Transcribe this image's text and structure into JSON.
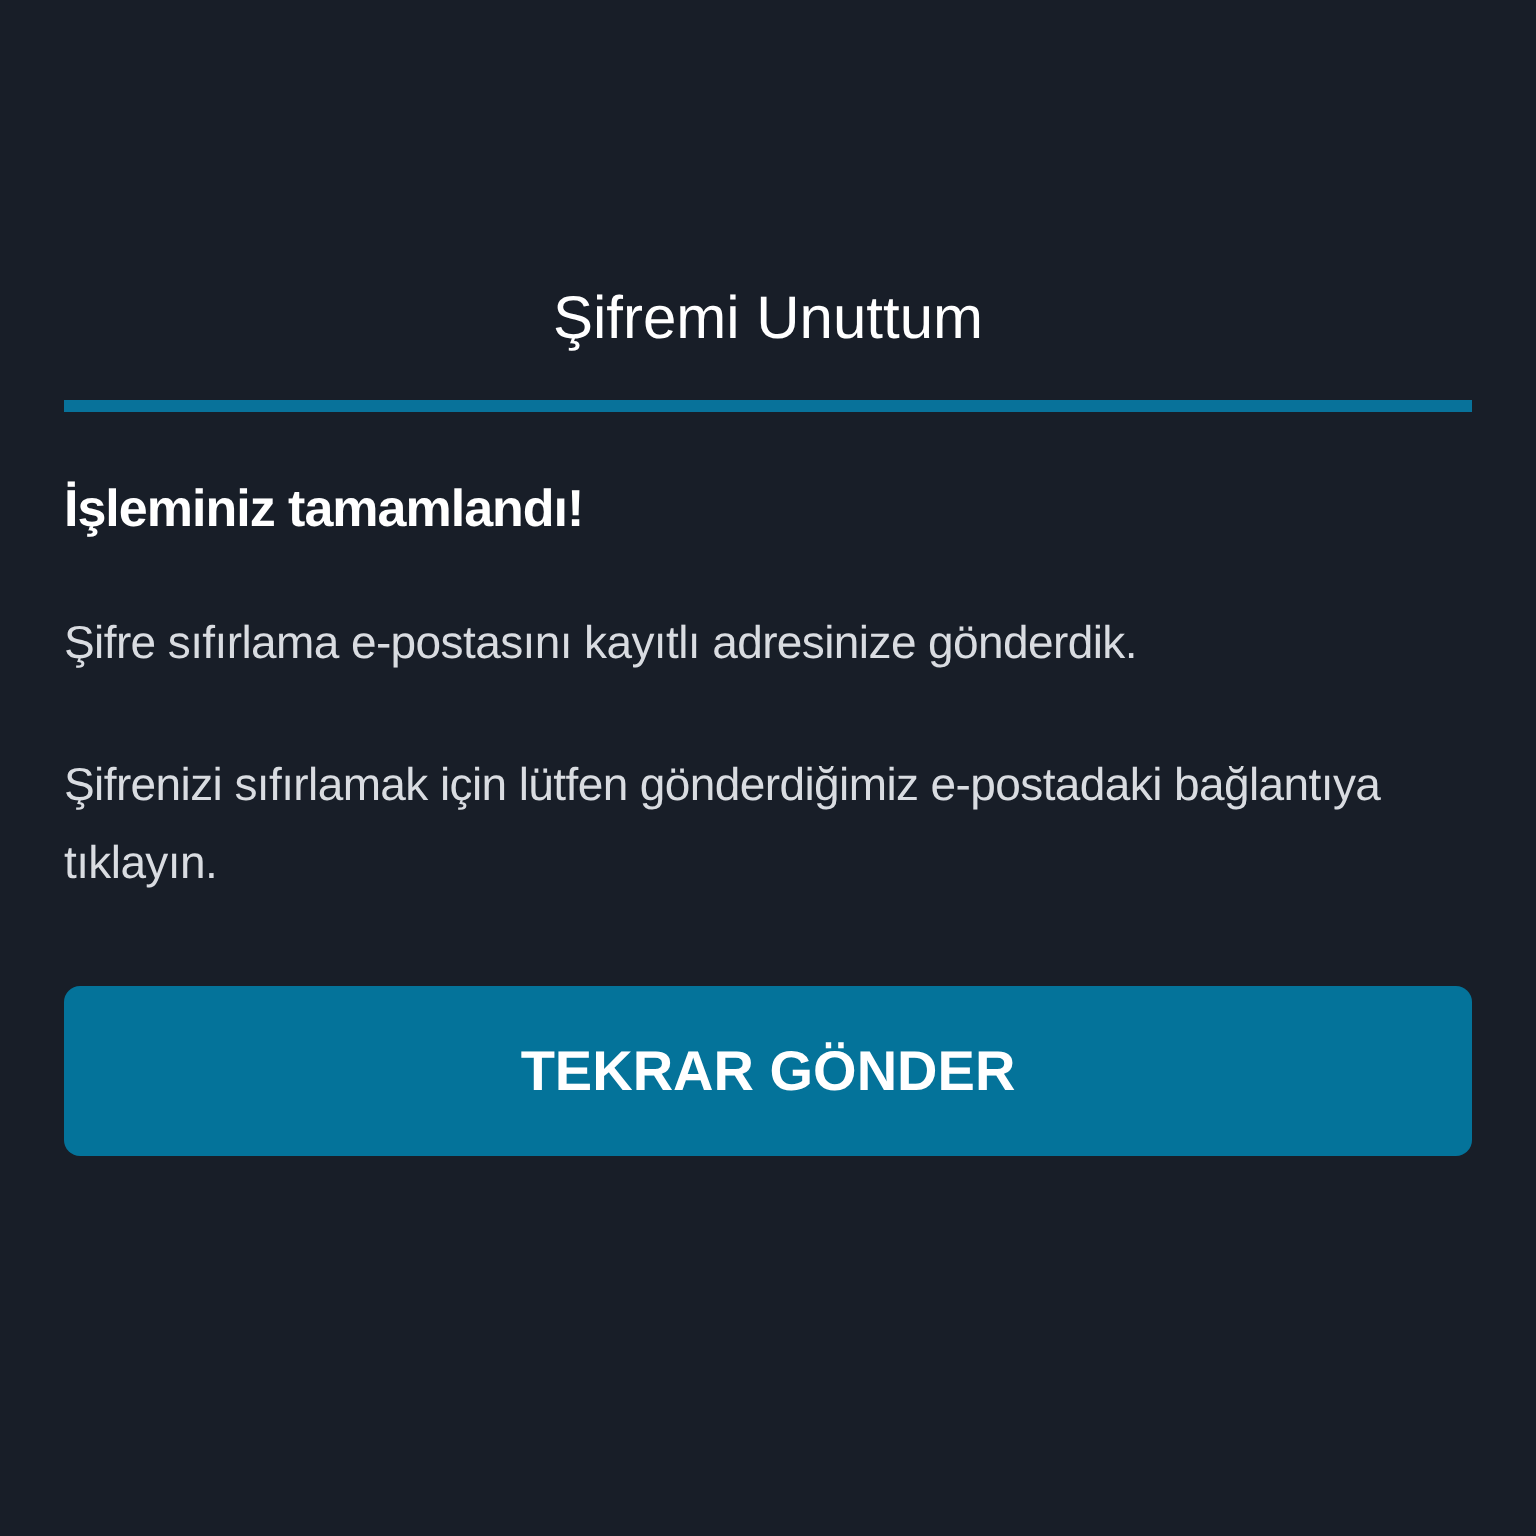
{
  "title": "Şifremi Unuttum",
  "heading": "İşleminiz tamamlandı!",
  "paragraphs": [
    "Şifre sıfırlama e-postasını kayıtlı adresinize gönderdik.",
    "Şifrenizi sıfırlamak için lütfen gönderdiğimiz e-postadaki bağlantıya tıklayın."
  ],
  "button": {
    "label": "TEKRAR GÖNDER"
  }
}
